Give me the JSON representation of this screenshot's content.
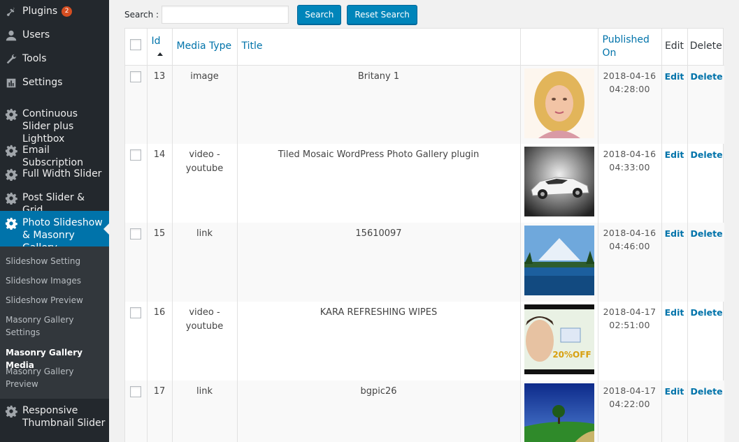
{
  "sidebar": {
    "items": [
      {
        "label": "Plugins",
        "badge": "2",
        "icon": "plugins-icon"
      },
      {
        "label": "Users",
        "icon": "users-icon"
      },
      {
        "label": "Tools",
        "icon": "tools-icon"
      },
      {
        "label": "Settings",
        "icon": "settings-icon"
      },
      {
        "label": "Continuous Slider plus Lightbox",
        "icon": "gear-icon"
      },
      {
        "label": "Email Subscription",
        "icon": "gear-icon"
      },
      {
        "label": "Full Width Slider",
        "icon": "gear-icon"
      },
      {
        "label": "Post Slider & Grid",
        "icon": "gear-icon"
      },
      {
        "label": "Photo Slideshow & Masonry Gallery",
        "icon": "gear-icon",
        "active": true
      },
      {
        "label": "Responsive Thumbnail Slider",
        "icon": "gear-icon"
      }
    ],
    "submenu": [
      {
        "label": "Slideshow Setting"
      },
      {
        "label": "Slideshow Images"
      },
      {
        "label": "Slideshow Preview"
      },
      {
        "label": "Masonry Gallery Settings"
      },
      {
        "label": "Masonry Gallery Media",
        "current": true
      },
      {
        "label": "Masonry Gallery Preview"
      }
    ]
  },
  "search": {
    "label": "Search :",
    "value": "",
    "placeholder": "",
    "search_button": "Search",
    "reset_button": "Reset Search"
  },
  "table": {
    "headers": {
      "id": "Id",
      "media_type": "Media Type",
      "title": "Title",
      "image": "",
      "published_on": "Published On",
      "edit": "Edit",
      "delete": "Delete"
    },
    "rows": [
      {
        "id": "13",
        "media_type": "image",
        "title": "Britany 1",
        "date": "2018-04-16",
        "time": "04:28:00",
        "edit": "Edit",
        "delete": "Delete",
        "thumb": "portrait-woman"
      },
      {
        "id": "14",
        "media_type": "video - youtube",
        "title": "Tiled Mosaic WordPress Photo Gallery plugin",
        "date": "2018-04-16",
        "time": "04:33:00",
        "edit": "Edit",
        "delete": "Delete",
        "thumb": "white-sports-car"
      },
      {
        "id": "15",
        "media_type": "link",
        "title": "15610097",
        "date": "2018-04-16",
        "time": "04:46:00",
        "edit": "Edit",
        "delete": "Delete",
        "thumb": "mountain-lake"
      },
      {
        "id": "16",
        "media_type": "video - youtube",
        "title": "KARA REFRESHING WIPES",
        "date": "2018-04-17",
        "time": "02:51:00",
        "edit": "Edit",
        "delete": "Delete",
        "thumb": "wipes-advert"
      },
      {
        "id": "17",
        "media_type": "link",
        "title": "bgpic26",
        "date": "2018-04-17",
        "time": "04:22:00",
        "edit": "Edit",
        "delete": "Delete",
        "thumb": "green-field-tree"
      }
    ]
  },
  "colors": {
    "sidebar_bg": "#23282d",
    "submenu_bg": "#32373c",
    "active_bg": "#0073aa",
    "link": "#0073aa",
    "button": "#0085ba",
    "badge": "#d54e21"
  }
}
